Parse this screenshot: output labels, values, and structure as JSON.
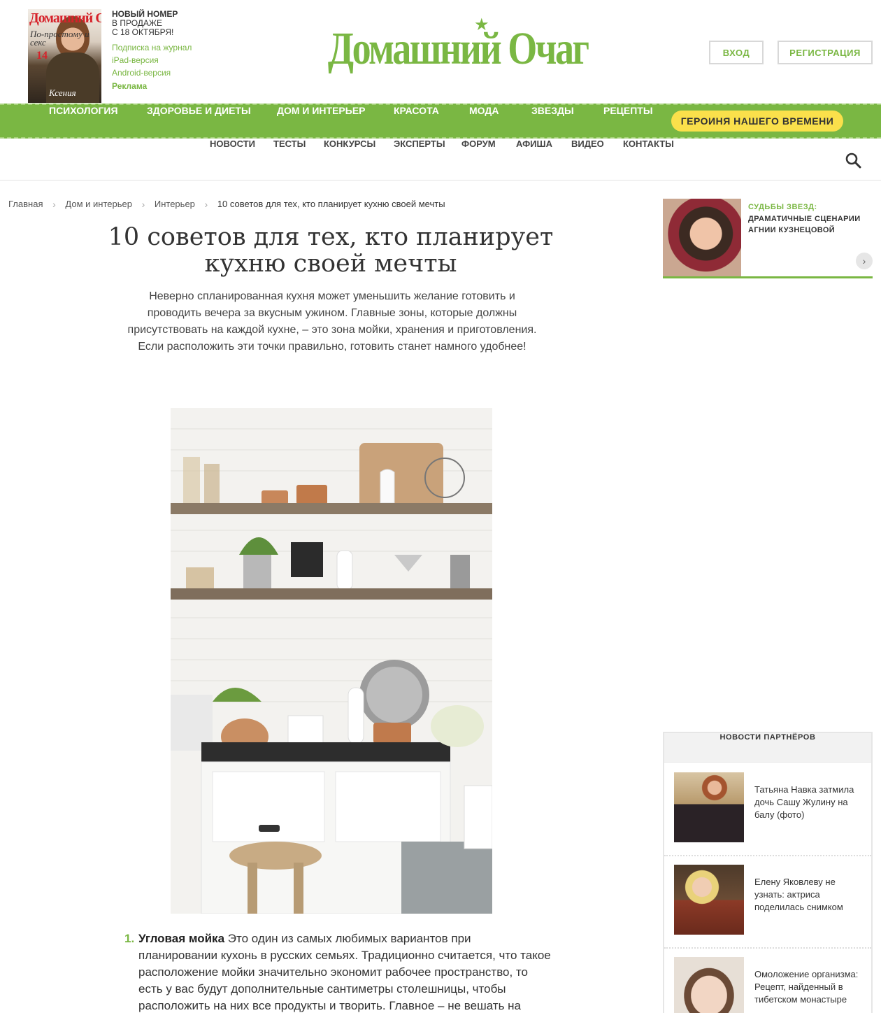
{
  "header": {
    "cover": {
      "masthead": "Домашний Очаг",
      "tagline": "По-простому и секс",
      "number": "14",
      "name": "Ксения"
    },
    "issue": {
      "label": "НОВЫЙ НОМЕР",
      "on_sale": "В ПРОДАЖЕ",
      "date": "С 18 ОКТЯБРЯ!",
      "links": [
        "Подписка на журнал",
        "iPad-версия",
        "Android-версия"
      ],
      "ad": "Реклама"
    },
    "logo": "Домашний Очаг",
    "login_label": "ВХОД",
    "register_label": "РЕГИСТРАЦИЯ"
  },
  "main_nav": {
    "items": [
      "ПСИХОЛОГИЯ",
      "ЗДОРОВЬЕ И ДИЕТЫ",
      "ДОМ И ИНТЕРЬЕР",
      "КРАСОТА",
      "МОДА",
      "ЗВЕЗДЫ",
      "РЕЦЕПТЫ"
    ],
    "highlight": "ГЕРОИНЯ НАШЕГО ВРЕМЕНИ"
  },
  "sub_nav": {
    "items": [
      "НОВОСТИ",
      "ТЕСТЫ",
      "КОНКУРСЫ",
      "ЭКСПЕРТЫ",
      "ФОРУМ",
      "АФИША",
      "ВИДЕО",
      "КОНТАКТЫ"
    ],
    "search_icon": "search-icon"
  },
  "breadcrumb": [
    "Главная",
    "Дом и интерьер",
    "Интерьер",
    "10 советов для тех, кто планирует кухню своей мечты"
  ],
  "article": {
    "title": "10 советов для тех, кто планирует кухню своей мечты",
    "lead": "Неверно спланированная кухня может уменьшить желание готовить и проводить вечера за вкусным ужином. Главные зоны, которые должны присутствовать на каждой кухне, – это зона мойки, хранения и приготовления. Если расположить эти точки правильно, готовить станет намного удобнее!",
    "list": [
      {
        "num": "1.",
        "heading": "Угловая мойка",
        "text": " Это один из самых любимых вариантов при планировании кухонь в русских семьях. Традиционно считается, что такое расположение мойки значительно экономит рабочее пространство, то есть у вас будут дополнительные сантиметры столешницы, чтобы расположить на них все продукты и творить. Главное – не вешать на"
      }
    ]
  },
  "sidebar": {
    "promo": {
      "kicker": "СУДЬБЫ ЗВЕЗД:",
      "headline": "ДРАМАТИЧНЫЕ СЦЕНАРИИ АГНИИ КУЗНЕЦОВОЙ",
      "next": "›"
    },
    "partners": {
      "title": "НОВОСТИ ПАРТНЁРОВ",
      "items": [
        "Татьяна Навка затмила дочь Сашу Жулину на балу (фото)",
        "Елену Яковлеву не узнать: актриса поделилась снимком",
        "Омоложение организма: Рецепт, найденный в тибетском монастыре"
      ]
    }
  },
  "colors": {
    "brand_green": "#7ab743",
    "highlight_yellow": "#fae04b"
  }
}
